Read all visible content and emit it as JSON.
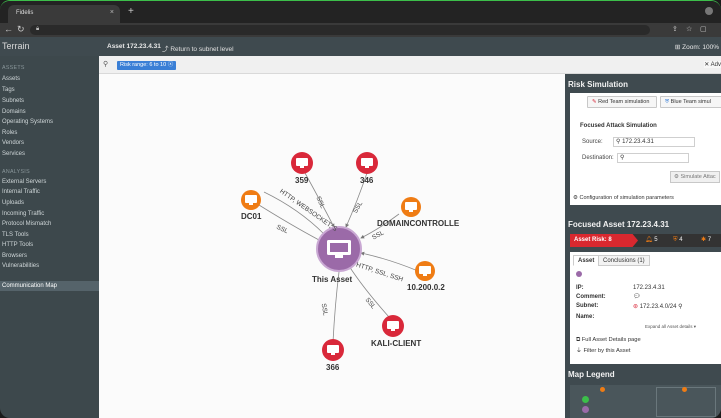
{
  "browser": {
    "tab_title": "Fidelis",
    "tab_close": "×",
    "new_tab": "+"
  },
  "header": {
    "brand": "Terrain",
    "asset_title": "Asset 172.23.4.31",
    "return_link": "Return to subnet level",
    "zoom": "Zoom: 100%"
  },
  "sidebar": {
    "assets_heading": "ASSETS",
    "asset_items": [
      "Assets",
      "Tags",
      "Subnets",
      "Domains",
      "Operating Systems",
      "Roles",
      "Vendors",
      "Services"
    ],
    "analysis_heading": "ANALYSIS",
    "analysis_items": [
      "External Servers",
      "Internal Traffic",
      "Uploads",
      "Incoming Traffic",
      "Protocol Mismatch",
      "TLS Tools",
      "HTTP Tools",
      "Browsers",
      "Vulnerabilities"
    ],
    "comm_map": "Communication Map"
  },
  "filter": {
    "chip": "Risk range: 6 to 10 ⓧ",
    "advanced": "✕ Adv"
  },
  "map": {
    "nodes": [
      {
        "id": "359",
        "label": "359",
        "kind": "red"
      },
      {
        "id": "346",
        "label": "346",
        "kind": "red"
      },
      {
        "id": "dc01",
        "label": "DC01",
        "kind": "orange"
      },
      {
        "id": "domaincontrolle",
        "label": "DOMAINCONTROLLE",
        "kind": "orange"
      },
      {
        "id": "this",
        "label": "This Asset",
        "kind": "center"
      },
      {
        "id": "10.200.0.2",
        "label": "10.200.0.2",
        "kind": "orange"
      },
      {
        "id": "kali",
        "label": "KALI-CLIENT",
        "kind": "red"
      },
      {
        "id": "366",
        "label": "366",
        "kind": "red"
      }
    ],
    "edge_labels": [
      "SSL",
      "SSL",
      "SSL",
      "HTTP, WEBSOCKET, S",
      "SSL",
      "HTTP, SSL, SSH",
      "SSL",
      "SSL"
    ]
  },
  "risk_sim": {
    "title": "Risk Simulation",
    "red_team": "Red Team simulation",
    "blue_team": "Blue Team simul",
    "focused_title": "Focused Attack Simulation",
    "source_label": "Source:",
    "source_value": "172.23.4.31",
    "destination_label": "Destination:",
    "simulate": "Simulate Attac",
    "config": "Configuration of simulation parameters"
  },
  "focused_asset": {
    "title": "Focused Asset 172.23.4.31",
    "risk_label": "Asset Risk:",
    "risk_value": "8",
    "counts": [
      "5",
      "4",
      "7"
    ],
    "tabs": [
      "Asset",
      "Conclusions (1)"
    ],
    "ip_label": "IP:",
    "ip_value": "172.23.4.31",
    "comment_label": "Comment:",
    "subnet_label": "Subnet:",
    "subnet_value": "172.23.4.0/24",
    "name_label": "Name:",
    "expand": "Expand all Asset details",
    "full_details": "Full Asset Details page",
    "filter_by": "Filter by this Asset"
  },
  "legend": {
    "title": "Map Legend"
  },
  "colors": {
    "red_node": "#d9283a",
    "orange_node": "#ef7c14",
    "center_node": "#9b6aa8",
    "risk_badge": "#d9282f"
  }
}
